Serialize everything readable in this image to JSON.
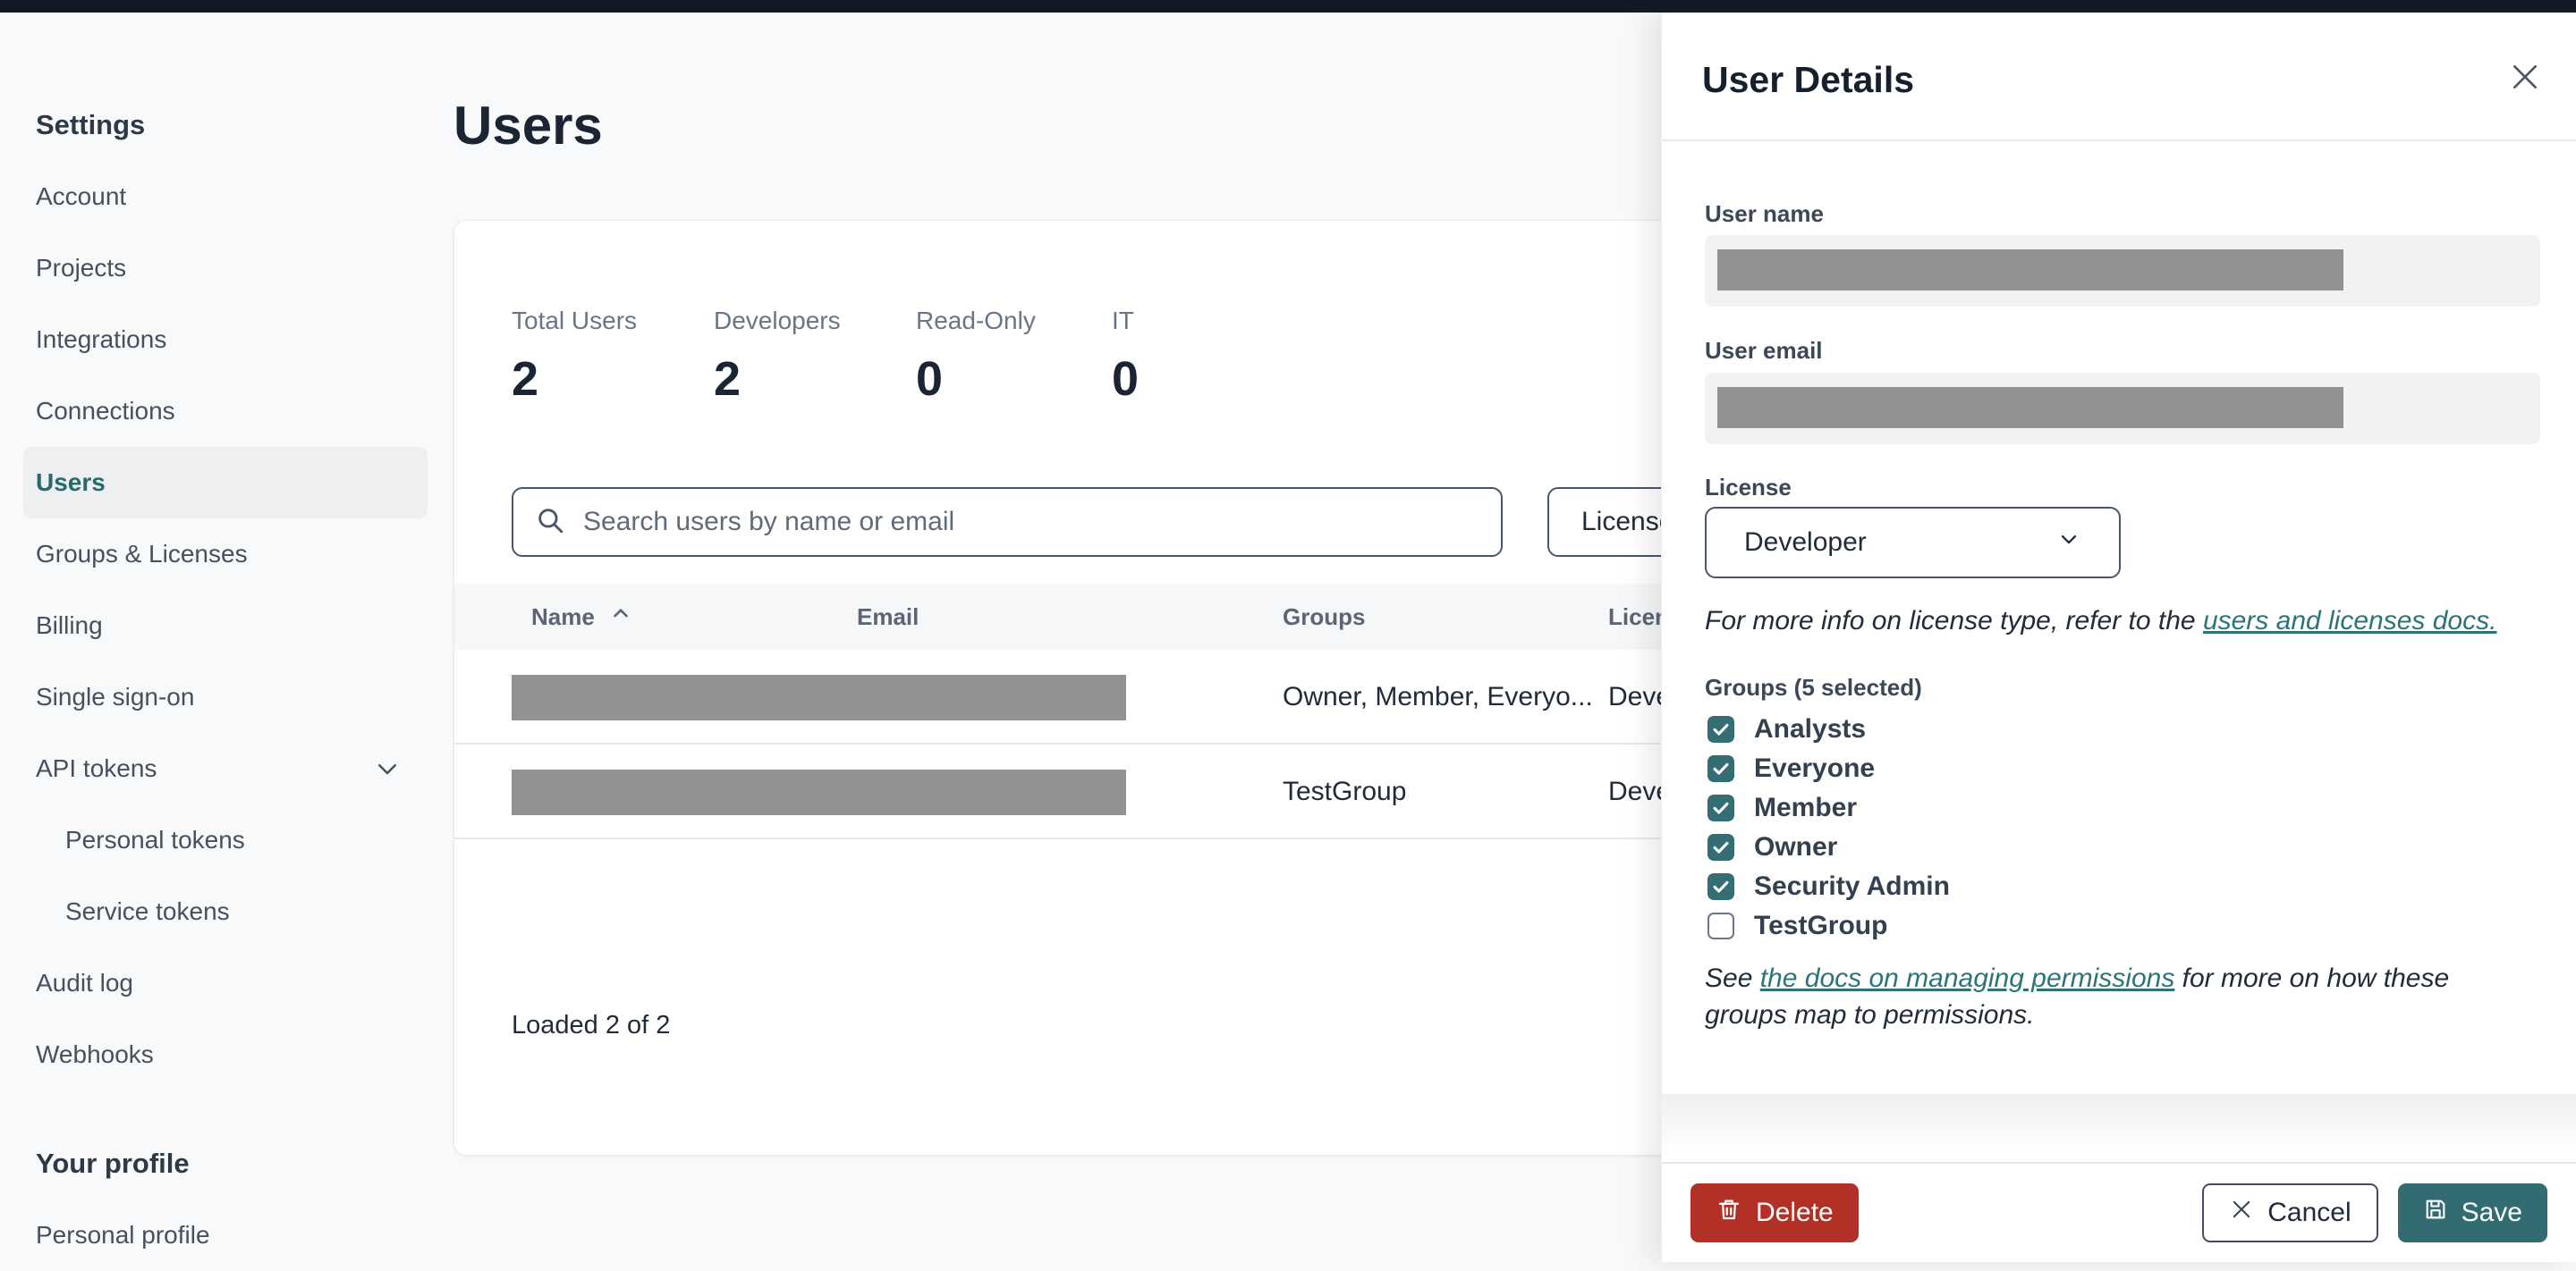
{
  "sidebar": {
    "section_title": "Settings",
    "items": [
      {
        "label": "Account"
      },
      {
        "label": "Projects"
      },
      {
        "label": "Integrations"
      },
      {
        "label": "Connections"
      },
      {
        "label": "Users"
      },
      {
        "label": "Groups & Licenses"
      },
      {
        "label": "Billing"
      },
      {
        "label": "Single sign-on"
      },
      {
        "label": "API tokens"
      },
      {
        "label": "Personal tokens"
      },
      {
        "label": "Service tokens"
      },
      {
        "label": "Audit log"
      },
      {
        "label": "Webhooks"
      }
    ],
    "profile_title": "Your profile",
    "profile_items": [
      {
        "label": "Personal profile"
      }
    ]
  },
  "main": {
    "page_title": "Users",
    "stats": [
      {
        "label": "Total Users",
        "value": "2"
      },
      {
        "label": "Developers",
        "value": "2"
      },
      {
        "label": "Read-Only",
        "value": "0"
      },
      {
        "label": "IT",
        "value": "0"
      }
    ],
    "search": {
      "placeholder": "Search users by name or email"
    },
    "license_filter_label": "License",
    "table": {
      "columns": {
        "name": "Name",
        "email": "Email",
        "groups": "Groups",
        "license": "License"
      },
      "rows": [
        {
          "groups": "Owner, Member, Everyo...",
          "license": "Developer"
        },
        {
          "groups": "TestGroup",
          "license": "Developer"
        }
      ]
    },
    "footer_text": "Loaded 2 of 2"
  },
  "drawer": {
    "title": "User Details",
    "user_name_label": "User name",
    "user_email_label": "User email",
    "license_label": "License",
    "license_value": "Developer",
    "license_note_prefix": "For more info on license type, refer to the ",
    "license_note_link": "users and licenses docs.",
    "groups_label": "Groups (5 selected)",
    "groups": [
      {
        "name": "Analysts",
        "checked": true
      },
      {
        "name": "Everyone",
        "checked": true
      },
      {
        "name": "Member",
        "checked": true
      },
      {
        "name": "Owner",
        "checked": true
      },
      {
        "name": "Security Admin",
        "checked": true
      },
      {
        "name": "TestGroup",
        "checked": false
      }
    ],
    "permissions_note_prefix": "See ",
    "permissions_note_link": "the docs on managing permissions",
    "permissions_note_suffix": " for more on how these groups map to permissions.",
    "delete_button": "Delete",
    "cancel_button": "Cancel",
    "save_button": "Save"
  },
  "colors": {
    "topbar": "#141927",
    "accent_teal": "#346e74",
    "save_teal": "#336b72",
    "link_teal": "#2b7478",
    "danger_red": "#b23025",
    "redaction_gray": "#929292",
    "active_item_text": "#28696d",
    "page_background": "#f8f9fa"
  }
}
